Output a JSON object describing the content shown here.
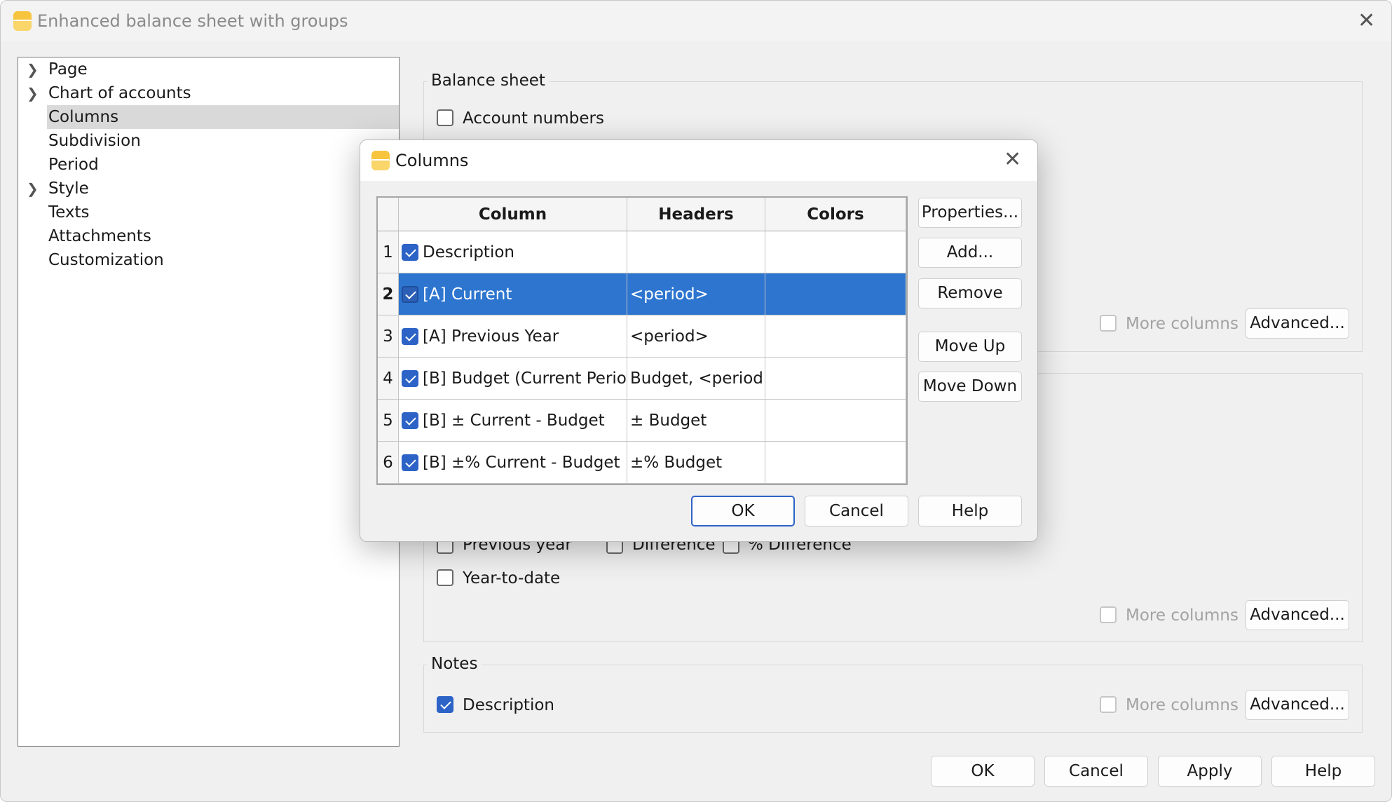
{
  "window": {
    "title": "Enhanced balance sheet with groups"
  },
  "tree": {
    "items": [
      {
        "label": "Page",
        "expandable": true
      },
      {
        "label": "Chart of accounts",
        "expandable": true
      },
      {
        "label": "Columns",
        "expandable": false,
        "selected": true
      },
      {
        "label": "Subdivision",
        "expandable": false
      },
      {
        "label": "Period",
        "expandable": false
      },
      {
        "label": "Style",
        "expandable": true
      },
      {
        "label": "Texts",
        "expandable": false
      },
      {
        "label": "Attachments",
        "expandable": false
      },
      {
        "label": "Customization",
        "expandable": false
      }
    ]
  },
  "balance_sheet": {
    "title": "Balance sheet",
    "account_numbers": {
      "label": "Account numbers",
      "checked": false
    },
    "more_columns": {
      "label": "More columns",
      "checked": false
    },
    "advanced_label": "Advanced..."
  },
  "columns_section": {
    "previous_year": {
      "label": "Previous year",
      "checked": false
    },
    "difference": {
      "label": "Difference",
      "checked": false
    },
    "pct_difference": {
      "label": "% Difference",
      "checked": false
    },
    "year_to_date": {
      "label": "Year-to-date",
      "checked": false
    },
    "more_columns": {
      "label": "More columns",
      "checked": false
    },
    "advanced_label": "Advanced..."
  },
  "notes": {
    "title": "Notes",
    "description": {
      "label": "Description",
      "checked": true
    },
    "more_columns": {
      "label": "More columns",
      "checked": false
    },
    "advanced_label": "Advanced..."
  },
  "footer": {
    "ok": "OK",
    "cancel": "Cancel",
    "apply": "Apply",
    "help": "Help"
  },
  "dialog": {
    "title": "Columns",
    "headers": [
      "Column",
      "Headers",
      "Colors"
    ],
    "rows": [
      {
        "num": "1",
        "checked": true,
        "column": "Description",
        "header": "",
        "colors": ""
      },
      {
        "num": "2",
        "checked": true,
        "column": "[A] Current",
        "header": "<period>",
        "colors": "",
        "selected": true
      },
      {
        "num": "3",
        "checked": true,
        "column": "[A] Previous Year",
        "header": "<period>",
        "colors": ""
      },
      {
        "num": "4",
        "checked": true,
        "column": "[B] Budget (Current Period)",
        "header": "Budget, <period>",
        "colors": ""
      },
      {
        "num": "5",
        "checked": true,
        "column": "[B] ± Current - Budget",
        "header": "± Budget",
        "colors": ""
      },
      {
        "num": "6",
        "checked": true,
        "column": "[B] ±% Current - Budget",
        "header": "±% Budget",
        "colors": ""
      }
    ],
    "side_buttons": {
      "properties": "Properties...",
      "add": "Add...",
      "remove": "Remove",
      "move_up": "Move Up",
      "move_down": "Move Down"
    },
    "ok": "OK",
    "cancel": "Cancel",
    "help": "Help"
  },
  "colors": {
    "accent": "#2d63c7",
    "selection": "#2d75cf",
    "app_icon": "#f7c43d"
  }
}
